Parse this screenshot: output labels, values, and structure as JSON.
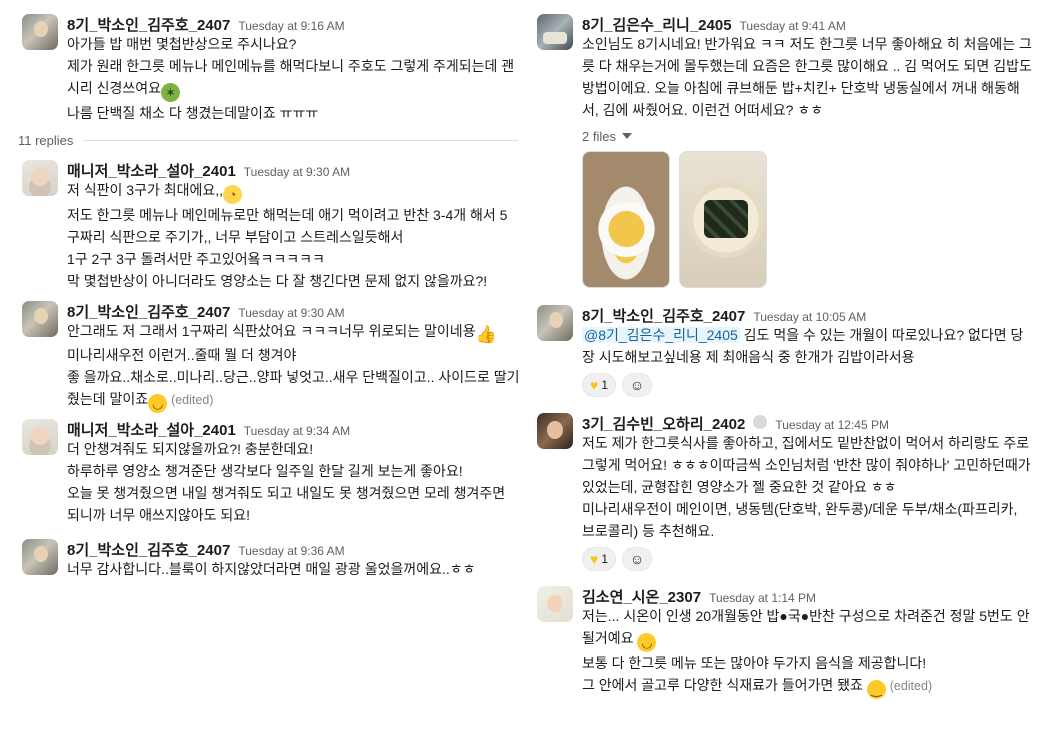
{
  "left_thread": {
    "messages": [
      {
        "author": "8기_박소인_김주호_2407",
        "time": "Tuesday at 9:16 AM",
        "lines": [
          "아가들 밥 매번 몇첩반상으로 주시나요?",
          "제가 원래 한그릇 메뉴나 메인메뉴를 해먹다보니 주호도 그렇게 주게되는데 괜",
          "시리 신경쓰여요",
          "나름 단백질 채소 다 챙겼는데말이죠 ㅠㅠㅠ"
        ],
        "emoji": "sick-face-emoji"
      },
      {
        "author": "매니저_박소라_설아_2401",
        "time": "Tuesday at 9:30 AM",
        "lines": [
          "저 식판이 3구가 최대에요,,",
          "저도 한그릇 메뉴나 메인메뉴로만 해먹는데 애기 먹이려고 반찬 3-4개 해서 5",
          "구짜리 식판으로 주기가,, 너무 부담이고 스트레스일듯해서",
          "1구 2구 3구 돌려서만 주고있어욬ㅋㅋㅋㅋㅋ",
          "막 몇첩반상이 아니더라도 영양소는 다 잘 챙긴다면 문제 없지 않을까요?!"
        ],
        "emoji": "rolling-eyes-emoji"
      },
      {
        "author": "8기_박소인_김주호_2407",
        "time": "Tuesday at 9:30 AM",
        "lines": [
          "안그래도 저 그래서 1구짜리 식판샀어요 ㅋㅋㅋ너무 위로되는 말이네용",
          "미나리새우전 이런거..줄때 뭘 더 챙겨야",
          "좋 을까요..채소로..미나리..당근..양파 넣엇고..새우 단백질이고.. 사이드로 딸기",
          "줬는데 말이죠"
        ],
        "edited": "(edited)"
      },
      {
        "author": "매니저_박소라_설아_2401",
        "time": "Tuesday at 9:34 AM",
        "lines": [
          "더 안챙겨줘도 되지않을까요?! 충분한데요!",
          "하루하루 영양소 챙겨준단 생각보다 일주일 한달 길게 보는게 좋아요!",
          "오늘 못 챙겨줬으면 내일 챙겨줘도 되고 내일도 못 챙겨줬으면 모레 챙겨주면",
          "되니까 너무 애쓰지않아도 되요!"
        ]
      },
      {
        "author": "8기_박소인_김주호_2407",
        "time": "Tuesday at 9:36 AM",
        "lines": [
          "너무 감사합니다..블룩이 하지않았더라면 매일 광광 울었을꺼에요..ㅎㅎ"
        ]
      }
    ],
    "replies_label": "11 replies"
  },
  "right_thread": {
    "messages": [
      {
        "author": "8기_김은수_리니_2405",
        "time": "Tuesday at 9:41 AM",
        "lines": [
          "소인님도 8기시네요! 반가워요 ㅋㅋ 저도 한그릇 너무 좋아해요 히 처음에는 그",
          "릇 다 채우는거에 몰두했는데 요즘은 한그릇 많이해요 .. 김 먹어도 되면 김밥도",
          "방법이에요. 오늘 아침에 큐브해둔 밥+치킨+ 단호박 냉동실에서 꺼내 해동해",
          "서, 김에 싸줬어요. 이런건 어떠세요? ㅎㅎ"
        ],
        "files_label": "2 files"
      },
      {
        "author": "8기_박소인_김주호_2407",
        "time": "Tuesday at 10:05 AM",
        "mention": "@8기_김은수_리니_2405",
        "lines": [
          " 김도 먹을 수 있는 개월이 따로있나요? 없다면 당",
          "장 시도해보고싶네용 제 최애음식 중 한개가 김밥이라서용"
        ],
        "reaction_count": "1"
      },
      {
        "author": "3기_김수빈_오하리_2402",
        "time": "Tuesday at 12:45 PM",
        "lines": [
          "저도 제가 한그릇식사를 좋아하고, 집에서도 밑반찬없이 먹어서 하리랑도 주로",
          "그렇게 먹어요! ㅎㅎㅎ이따금씩 소인님처럼 '반찬 많이 줘야하나' 고민하던때가",
          "있었는데, 균형잡힌 영양소가 젤 중요한 것 같아요 ㅎㅎ",
          "미나리새우전이 메인이면, 냉동템(단호박, 완두콩)/데운 두부/채소(파프리카,",
          "브로콜리) 등 추천해요."
        ],
        "reaction_count": "1"
      },
      {
        "author": "김소연_시온_2307",
        "time": "Tuesday at 1:14 PM",
        "lines": [
          "저는... 시온이 인생 20개월동안 밥●국●반찬 구성으로 차려준건 정말 5번도 안",
          "될거예요",
          "보통 다 한그릇 메뉴 또는 많아야 두가지 음식을 제공합니다!",
          "그 안에서 골고루 다양한 식재료가 들어가면 됐죠"
        ],
        "edited": "(edited)"
      }
    ]
  },
  "colors": {
    "text": "#1d1c1d",
    "muted": "#616061",
    "mention": "#1264a3",
    "reaction_bg": "#f0f0f0"
  }
}
